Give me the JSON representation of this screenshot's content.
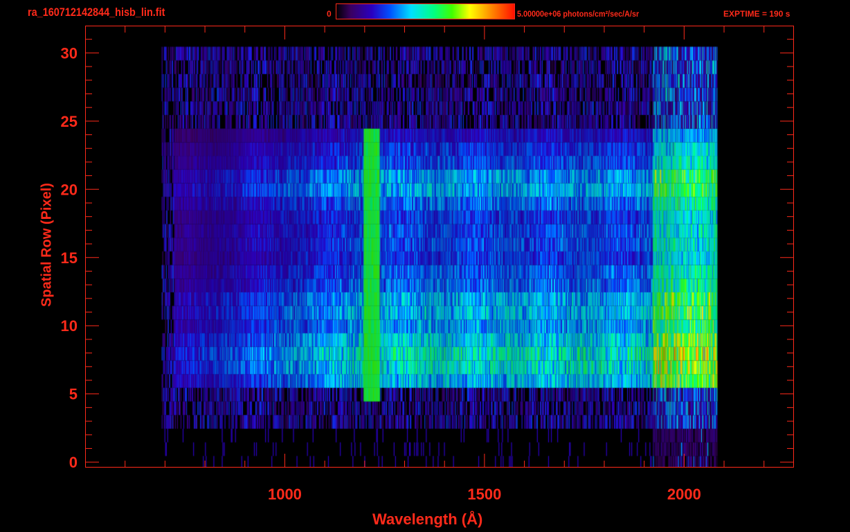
{
  "chart_data": {
    "type": "heatmap",
    "title": "ra_160712142844_hisb_lin.fit",
    "colorbar": {
      "min_label": "0",
      "max_label": "5.00000e+06 photons/cm²/sec/A/sr",
      "min": 0,
      "max": 5000000
    },
    "annotation": "EXPTIME = 190 s",
    "xlabel": "Wavelength (Å)",
    "ylabel": "Spatial Row (Pixel)",
    "xlim": [
      500,
      2275
    ],
    "ylim": [
      -0.4,
      32
    ],
    "xticks": [
      1000,
      1500,
      2000
    ],
    "yticks": [
      0,
      5,
      10,
      15,
      20,
      25,
      30
    ],
    "data_extent": {
      "wavelength": [
        690,
        2080
      ],
      "rows": [
        0,
        30
      ]
    },
    "bright_rows": {
      "region_rows": [
        6,
        24
      ],
      "peak_rows": [
        7,
        8,
        9,
        11,
        12,
        20,
        21
      ]
    },
    "emission_line": {
      "wavelength": 1216,
      "rows": [
        5,
        24
      ]
    },
    "colors": {
      "axis": "#ff2a1a",
      "background": "#000000"
    }
  }
}
